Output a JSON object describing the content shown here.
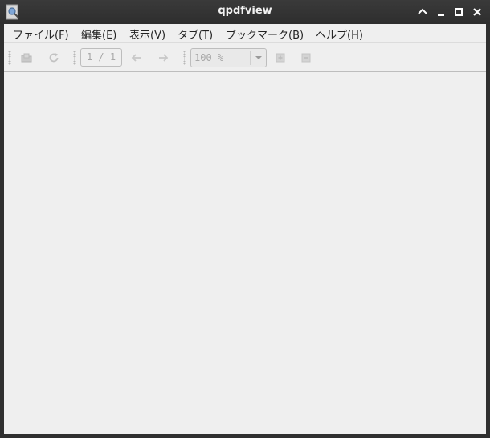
{
  "window": {
    "title": "qpdfview"
  },
  "menubar": {
    "items": [
      {
        "label": "ファイル(F)"
      },
      {
        "label": "編集(E)"
      },
      {
        "label": "表示(V)"
      },
      {
        "label": "タブ(T)"
      },
      {
        "label": "ブックマーク(B)"
      },
      {
        "label": "ヘルプ(H)"
      }
    ]
  },
  "toolbar": {
    "page_indicator": "1 / 1",
    "zoom_value": "100 %"
  },
  "icons": {
    "app": "document-viewer-icon",
    "minimize": "chevron-up-icon",
    "maximize": "square-icon",
    "close": "close-icon",
    "open": "open-folder-icon",
    "refresh": "refresh-icon",
    "previous": "arrow-left-icon",
    "next": "arrow-right-icon",
    "zoom_in": "zoom-in-icon",
    "zoom_out": "zoom-out-icon"
  },
  "colors": {
    "titlebar": "#2f2f2f",
    "background": "#efefef",
    "disabled_text": "#a8a8a8"
  }
}
